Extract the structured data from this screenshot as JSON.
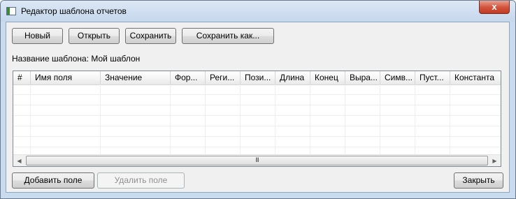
{
  "window": {
    "title": "Редактор шаблона отчетов",
    "close_glyph": "x"
  },
  "toolbar": {
    "new_label": "Новый",
    "open_label": "Открыть",
    "save_label": "Сохранить",
    "save_as_label": "Сохранить как..."
  },
  "template_name": {
    "label": "Название шаблона: Мой шаблон"
  },
  "table": {
    "columns": [
      "#",
      "Имя поля",
      "Значение",
      "Фор...",
      "Реги...",
      "Пози...",
      "Длина",
      "Конец",
      "Выра...",
      "Симв...",
      "Пуст...",
      "Константа"
    ],
    "rows": []
  },
  "scrollbar": {
    "left_arrow": "◀",
    "right_arrow": "▶",
    "grip": "III"
  },
  "footer": {
    "add_field_label": "Добавить поле",
    "delete_field_label": "Удалить поле",
    "close_label": "Закрыть"
  },
  "icons": {
    "app": "form-window-icon",
    "close": "close-icon"
  }
}
